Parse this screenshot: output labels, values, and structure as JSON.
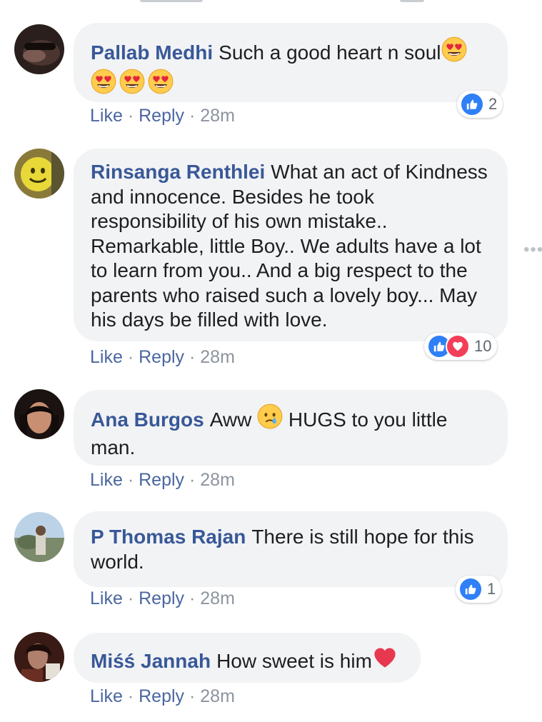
{
  "comments": [
    {
      "author": "Pallab Medhi",
      "text": "Such a good heart n soul",
      "emoji_icons": [
        "heart-eyes-icon",
        "heart-eyes-icon",
        "heart-eyes-icon",
        "heart-eyes-icon"
      ],
      "actions": {
        "like": "Like",
        "reply": "Reply",
        "time": "28m"
      },
      "reactions": {
        "types": [
          "like"
        ],
        "count": "2"
      }
    },
    {
      "author": "Rinsanga Renthlei",
      "text": "What an act of Kindness and innocence. Besides he took responsibility of his own mistake.. Remarkable, little Boy.. We adults have a lot to learn from you.. And a big respect to the parents who raised such a lovely boy... May his days be filled with love.",
      "actions": {
        "like": "Like",
        "reply": "Reply",
        "time": "28m"
      },
      "reactions": {
        "types": [
          "like",
          "love"
        ],
        "count": "10"
      }
    },
    {
      "author": "Ana Burgos",
      "text_before": "Aww",
      "emoji_icons": [
        "crying-face-icon"
      ],
      "text_after": "HUGS to you little man.",
      "actions": {
        "like": "Like",
        "reply": "Reply",
        "time": "28m"
      }
    },
    {
      "author": "P Thomas Rajan",
      "text": "There is still hope for this world.",
      "actions": {
        "like": "Like",
        "reply": "Reply",
        "time": "28m"
      },
      "reactions": {
        "types": [
          "like"
        ],
        "count": "1"
      }
    },
    {
      "author": "Miśś Jannah",
      "text": "How sweet is him",
      "emoji_icons": [
        "red-heart-icon"
      ],
      "actions": {
        "like": "Like",
        "reply": "Reply",
        "time": "28m"
      }
    }
  ],
  "colors": {
    "author": "#385898",
    "bubble": "#f2f3f5",
    "action_link": "#4b67a1",
    "meta": "#8d949e",
    "like_blue": "#2f80f7",
    "love_red": "#f33e58"
  },
  "separator": "·"
}
